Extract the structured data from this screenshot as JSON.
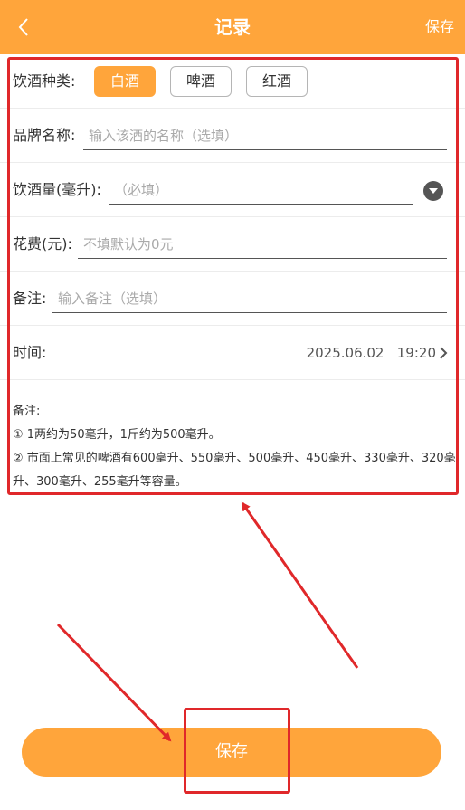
{
  "header": {
    "title": "记录",
    "save_label": "保存"
  },
  "drink_type": {
    "label": "饮酒种类:",
    "options": [
      "白酒",
      "啤酒",
      "红酒"
    ],
    "selected": "白酒"
  },
  "brand": {
    "label": "品牌名称:",
    "value": "",
    "placeholder": "输入该酒的名称（选填）"
  },
  "volume": {
    "label": "饮酒量(毫升):",
    "value": "",
    "placeholder": "（必填）"
  },
  "cost": {
    "label": "花费(元):",
    "value": "",
    "placeholder": "不填默认为0元"
  },
  "remark": {
    "label": "备注:",
    "value": "",
    "placeholder": "输入备注（选填）"
  },
  "time": {
    "label": "时间:",
    "value": "2025.06.02   19:20"
  },
  "notes": {
    "title": "备注:",
    "line1": "① 1两约为50毫升，1斤约为500毫升。",
    "line2": "② 市面上常见的啤酒有600毫升、550毫升、500毫升、450毫升、330毫升、320毫升、300毫升、255毫升等容量。"
  },
  "footer": {
    "save_label": "保存"
  },
  "colors": {
    "accent": "#ffa53b",
    "annotation": "#e0282a"
  }
}
